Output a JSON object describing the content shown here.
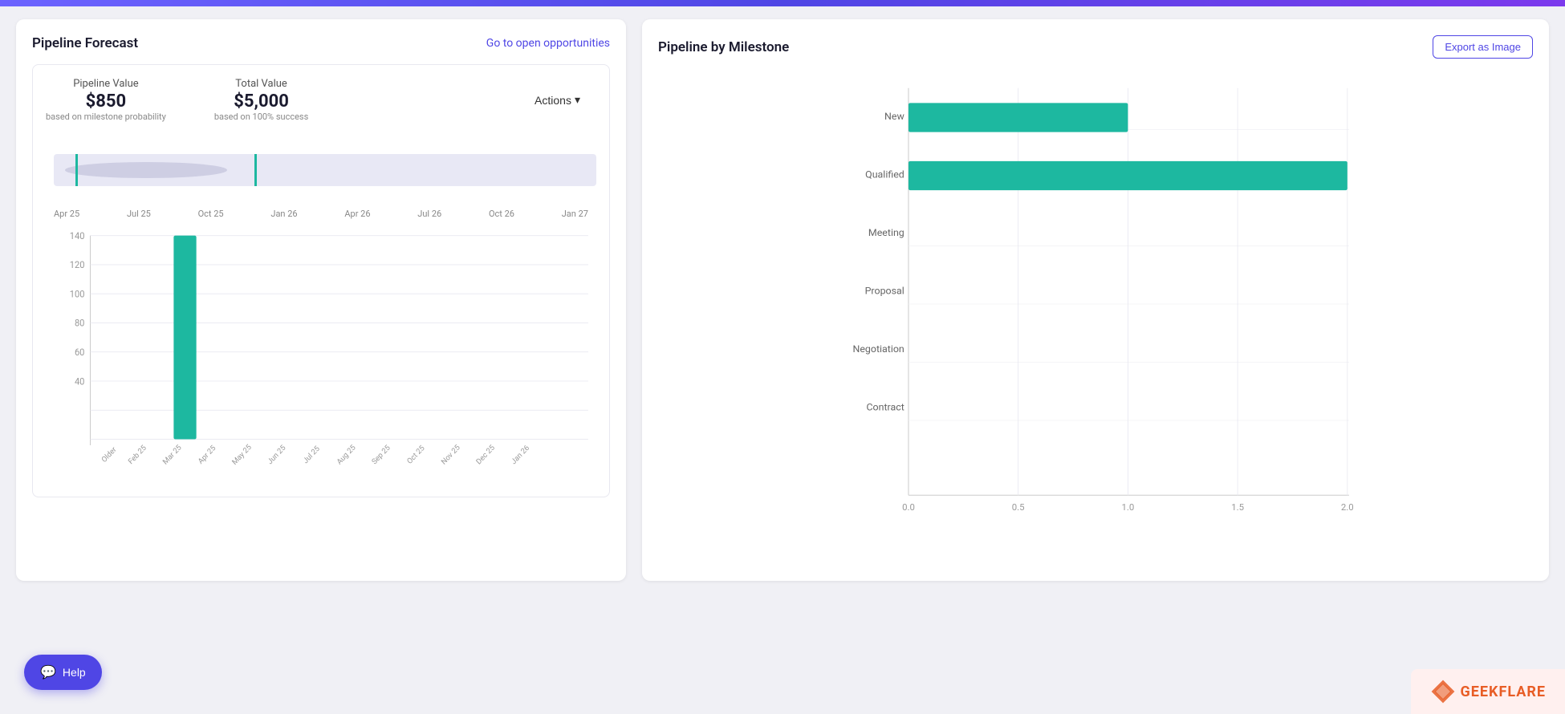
{
  "topBar": {},
  "leftCard": {
    "title": "Pipeline Forecast",
    "linkLabel": "Go to open opportunities",
    "metrics": {
      "pipelineLabel": "Pipeline Value",
      "pipelineValue": "$850",
      "pipelineSub": "based on milestone probability",
      "totalLabel": "Total Value",
      "totalValue": "$5,000",
      "totalSub": "based on 100% success",
      "actionsLabel": "Actions"
    },
    "timelineLabels": [
      "Apr 25",
      "Jul 25",
      "Oct 25",
      "Jan 26",
      "Apr 26",
      "Jul 26",
      "Oct 26",
      "Jan 27"
    ],
    "barChartYLabels": [
      "140",
      "120",
      "100",
      "80",
      "60",
      "40"
    ],
    "barChartXLabels": [
      "Older",
      "Feb 25",
      "Mar 25",
      "Apr 25",
      "May 25",
      "Jun 25",
      "Jul 25",
      "Aug 25",
      "Sep 25",
      "Oct 25",
      "Nov 25",
      "Dec 25",
      "Jan 26"
    ]
  },
  "rightCard": {
    "title": "Pipeline by Milestone",
    "exportLabel": "Export as Image",
    "milestones": [
      "New",
      "Qualified",
      "Meeting",
      "Proposal",
      "Negotiation",
      "Contract"
    ],
    "xLabels": [
      "0.0",
      "0.5",
      "1.0",
      "1.5",
      "2.0"
    ],
    "bars": [
      {
        "label": "New",
        "value": 1.0,
        "maxVal": 2.0
      },
      {
        "label": "Qualified",
        "value": 2.0,
        "maxVal": 2.0
      },
      {
        "label": "Meeting",
        "value": 0,
        "maxVal": 2.0
      },
      {
        "label": "Proposal",
        "value": 0,
        "maxVal": 2.0
      },
      {
        "label": "Negotiation",
        "value": 0,
        "maxVal": 2.0
      },
      {
        "label": "Contract",
        "value": 0,
        "maxVal": 2.0
      }
    ]
  },
  "helpButton": {
    "label": "Help"
  },
  "footer": {
    "brandName": "GEEKFLARE"
  }
}
